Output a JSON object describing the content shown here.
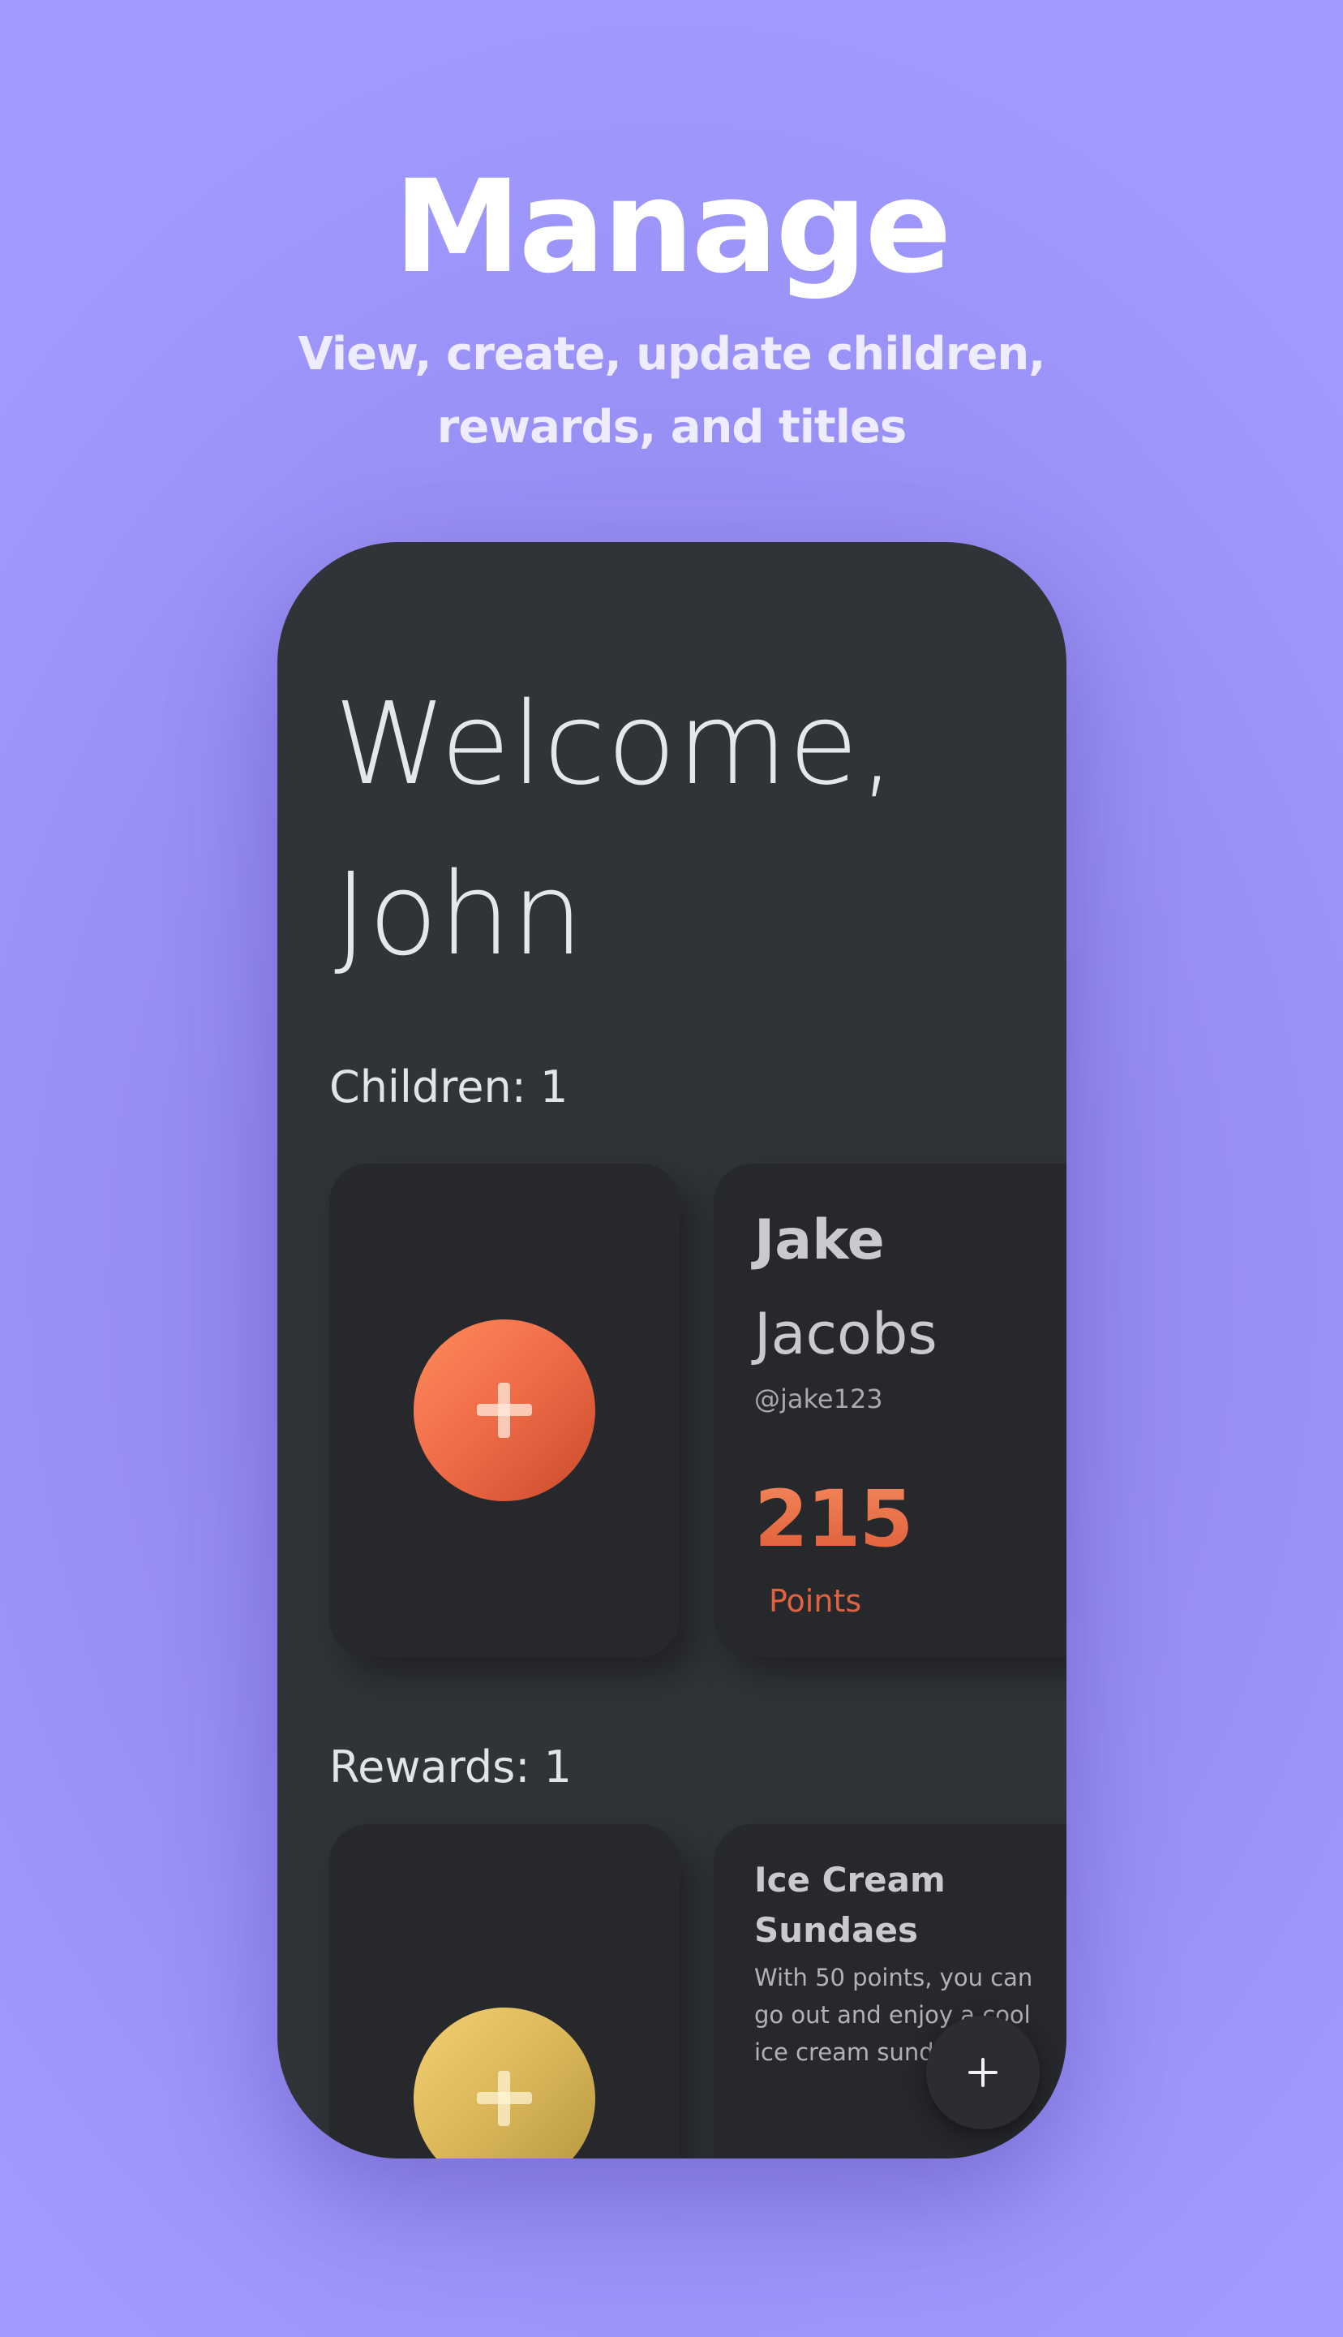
{
  "hero": {
    "title": "Manage",
    "subtitle": "View, create, update children, rewards, and titles"
  },
  "screen": {
    "welcome_line1": "Welcome,",
    "welcome_line2": "John",
    "children_label": "Children: 1",
    "rewards_label": "Rewards: 1",
    "child": {
      "first_name": "Jake",
      "last_name": "Jacobs",
      "username": "@jake123",
      "points": "215",
      "points_label": "Points"
    },
    "reward": {
      "title": "Ice Cream Sundaes",
      "description": "With 50 points, you can go out and enjoy a cool ice cream sundae."
    }
  },
  "icons": {
    "add_child": "plus-icon",
    "add_reward": "plus-icon",
    "fab": "plus-icon"
  },
  "colors": {
    "background": "#a19afe",
    "phone_surface": "#303337",
    "card_surface": "#26282c",
    "accent_orange": "#ee6b47",
    "accent_gold": "#d9b658"
  }
}
